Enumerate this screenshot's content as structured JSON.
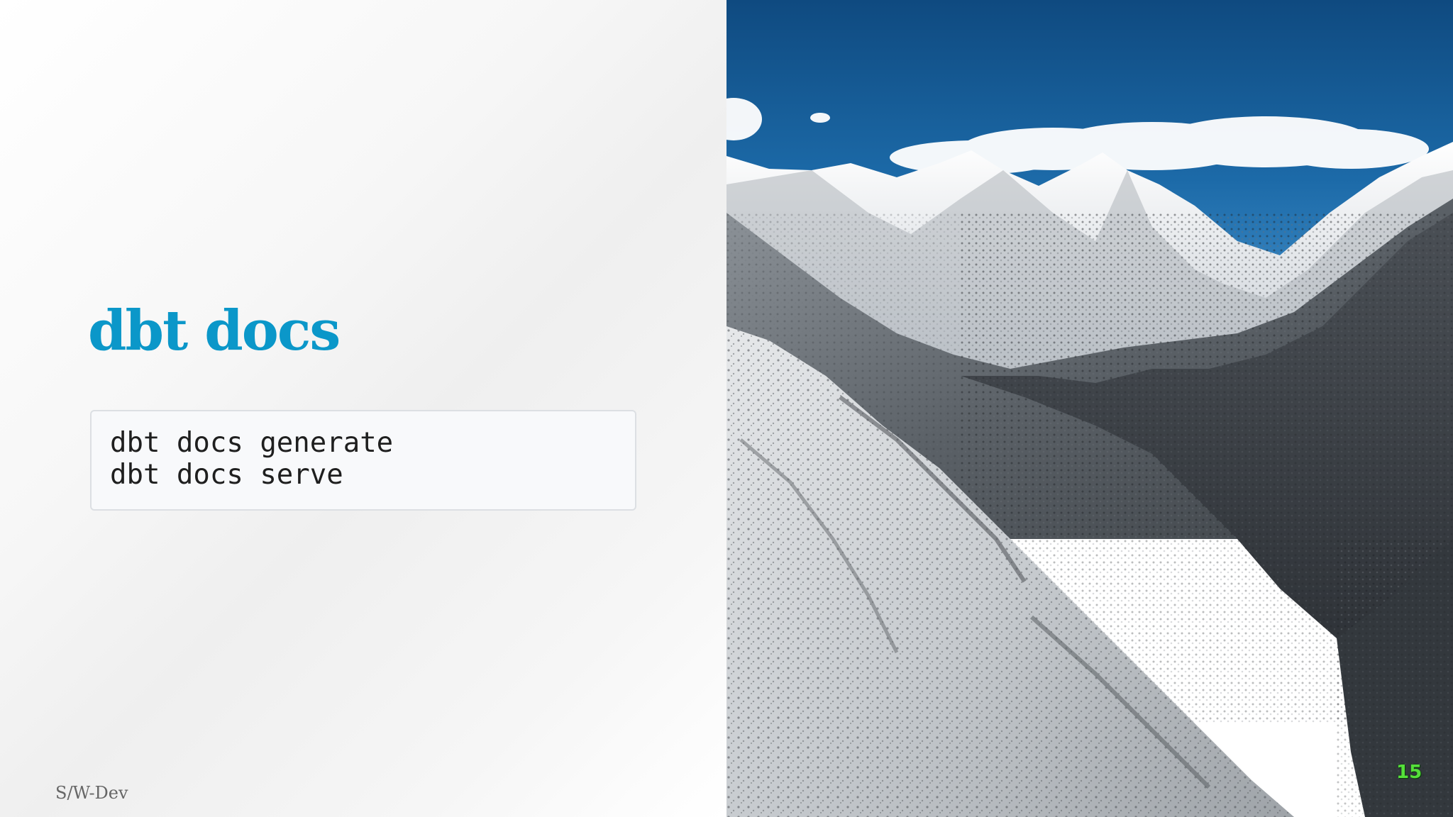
{
  "slide": {
    "title": "dbt docs",
    "code_lines": [
      "dbt docs generate",
      "dbt docs serve"
    ],
    "footer_brand": "S/W-Dev",
    "page_number": "15"
  },
  "colors": {
    "title": "#0b97c9",
    "page_number": "#55e03a"
  },
  "image": {
    "subject": "snow-covered-mountains-photo"
  }
}
